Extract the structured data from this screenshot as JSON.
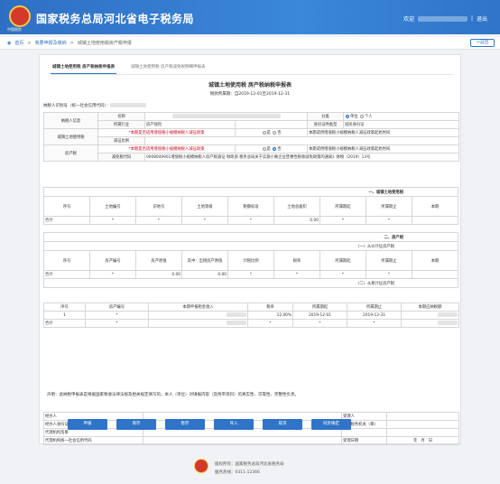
{
  "header": {
    "title": "国家税务总局河北省电子税务局",
    "logo_subtitle": "中国税务",
    "welcome": "欢迎",
    "logout": "退出",
    "sep": "|"
  },
  "breadcrumb": {
    "home": "首页",
    "level1": "我要申报及缴纳",
    "sep": ">",
    "current": "城镇土地使用税房产税申报"
  },
  "back_label": "返回",
  "tabs": [
    "城镇土地使用税 房产税纳税申报表",
    "城镇土地使用税 房产税减免税明细申报表"
  ],
  "form": {
    "title": "城镇土地使用税 房产税纳税申报表",
    "period": "税款所属期：自2019-12-01至2019-12-31",
    "taxid_label": "纳税人识别号（统一社会信用代码）：",
    "taxpayer_info": "纳税人信息",
    "name_label": "名称",
    "category_label": "分类",
    "cat_unit": "单位",
    "cat_individual": "个人",
    "industry_label": "所属行业",
    "industry_value": "房产保险",
    "idtype_label": "身份证件类型",
    "idtype_value": "居民身份证",
    "land_tax_info": "城镇土地使用税",
    "small_question": "*本期是否适用增值税小规模纳税人减征政策",
    "yes": "是",
    "no": "否",
    "reduction_label": "本期适用增值税小规模纳税人减征政策起始时间",
    "reduction_ratio_label": "减征比例",
    "property_info": "房产税",
    "reduction_property": "减免税代码",
    "property_reduction_value": "0008049901增值税小规模纳税人房产税减征 财政部 税务总局关于实施小微企业普惠性税收减免政策的通知》财税〔2019〕13号",
    "sec1": "一、城镇土地使用税",
    "sec1_headers": [
      "序号",
      "土地编号",
      "宗地号",
      "土地等级",
      "税额标准",
      "土地总面积",
      "所属期起",
      "所属期止",
      "本期"
    ],
    "total_label": "合计",
    "star": "*",
    "sec1_total_area": "0.00",
    "sec2": "二、房产税",
    "sub1": "（一）从价计征房产税",
    "sub1_headers": [
      "序号",
      "房产编号",
      "房产原值",
      "其中：出租房产原值",
      "计税比例",
      "税率",
      "所属期起",
      "所属期止",
      "本期"
    ],
    "sub1_total_value": "0.00",
    "sub1_total_rent": "0.00",
    "sub2": "（二）从租计征房产税",
    "sub2_headers": [
      "序号",
      "房产编号",
      "本期申报租金收入",
      "税率",
      "所属期起",
      "所属期止",
      "本期应纳税额"
    ],
    "sub2_row": {
      "idx": "1",
      "rate": "12.00%",
      "start": "2019-12-01",
      "end": "2019-12-31"
    },
    "declaration": "声明：此纳税申报表是根据国家税收法律法规及相关规定填写的，本人（单位）对填报内容（及附带资料）的真实性、可靠性、完整性负责。",
    "sign": {
      "handler": "经办人",
      "handler_id": "经办人身份证号",
      "agent": "代理机构签章",
      "agent_code": "代理机构统一社会信用代码",
      "receiver": "受理人",
      "receiver_org": "受理税务机关（章）",
      "receive_date": "受理日期",
      "year": "年",
      "month": "月",
      "day": "日"
    }
  },
  "buttons": [
    "申报",
    "保存",
    "暂存",
    "导入",
    "取消",
    "同步确定"
  ],
  "footer": {
    "copyright": "版权所有：国家税务总局河北省税务局",
    "hotline": "服务热线：0311-12366"
  }
}
